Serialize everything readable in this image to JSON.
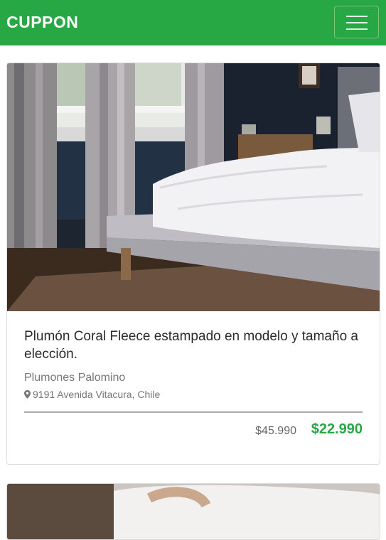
{
  "header": {
    "brand": "CUPPON",
    "menu_icon": "hamburger-menu-icon",
    "color": "#28a745"
  },
  "deal": {
    "image_alt": "Bed with white duvet in a dark bedroom",
    "title": "Plumón Coral Fleece estampado en modelo y tamaño a elección.",
    "merchant": "Plumones Palomino",
    "location_icon": "map-pin-icon",
    "location": "9191 Avenida Vitacura, Chile",
    "old_price": "$45.990",
    "new_price": "$22.990",
    "price_color": "#28a745"
  }
}
